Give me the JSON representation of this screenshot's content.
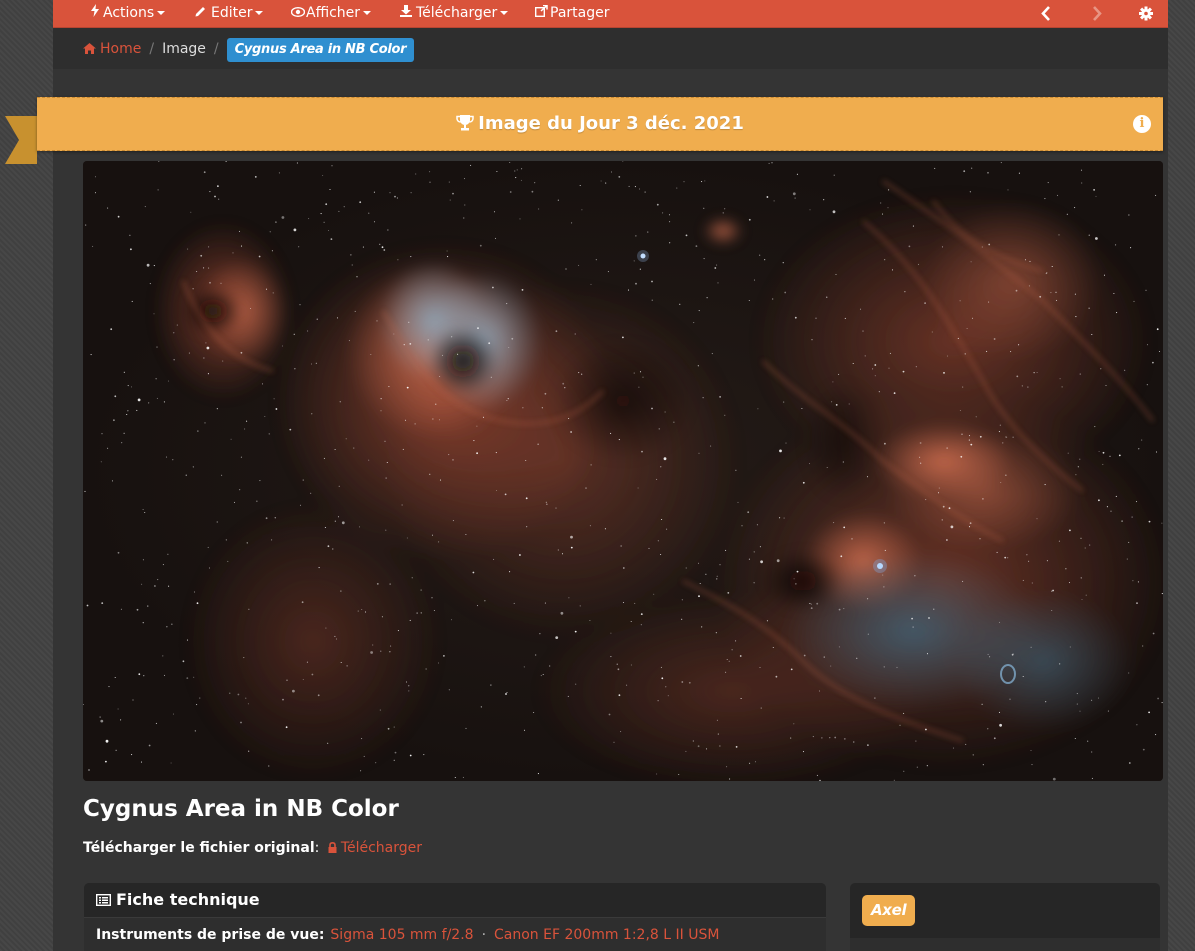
{
  "toolbar": {
    "actions_label": "Actions",
    "edit_label": "Editer",
    "view_label": "Afficher",
    "download_label": "Télécharger",
    "share_label": "Partager",
    "prev_icon": "chevron-left-icon",
    "next_icon": "chevron-right-icon",
    "settings_icon": "gear-icon"
  },
  "breadcrumb": {
    "home": "Home",
    "section": "Image",
    "current": "Cygnus Area in NB Color"
  },
  "iotd": {
    "label": "Image du Jour 3 déc. 2021",
    "icon": "trophy-icon",
    "info_icon": "info-icon"
  },
  "image": {
    "title": "Cygnus Area in NB Color",
    "download_label": "Télécharger le fichier original",
    "download_link": "Télécharger"
  },
  "tech_panel": {
    "title": "Fiche technique",
    "instruments_label": "Instruments de prise de vue:",
    "instruments": [
      "Sigma 105 mm f/2.8",
      "Canon EF 200mm 1:2,8 L II USM"
    ]
  },
  "user": {
    "name": "Axel"
  },
  "colors": {
    "toolbar": "#d9533b",
    "accent_link": "#d9533b",
    "iotd_banner": "#f0ad4e",
    "breadcrumb_active": "#2f8fd0"
  }
}
